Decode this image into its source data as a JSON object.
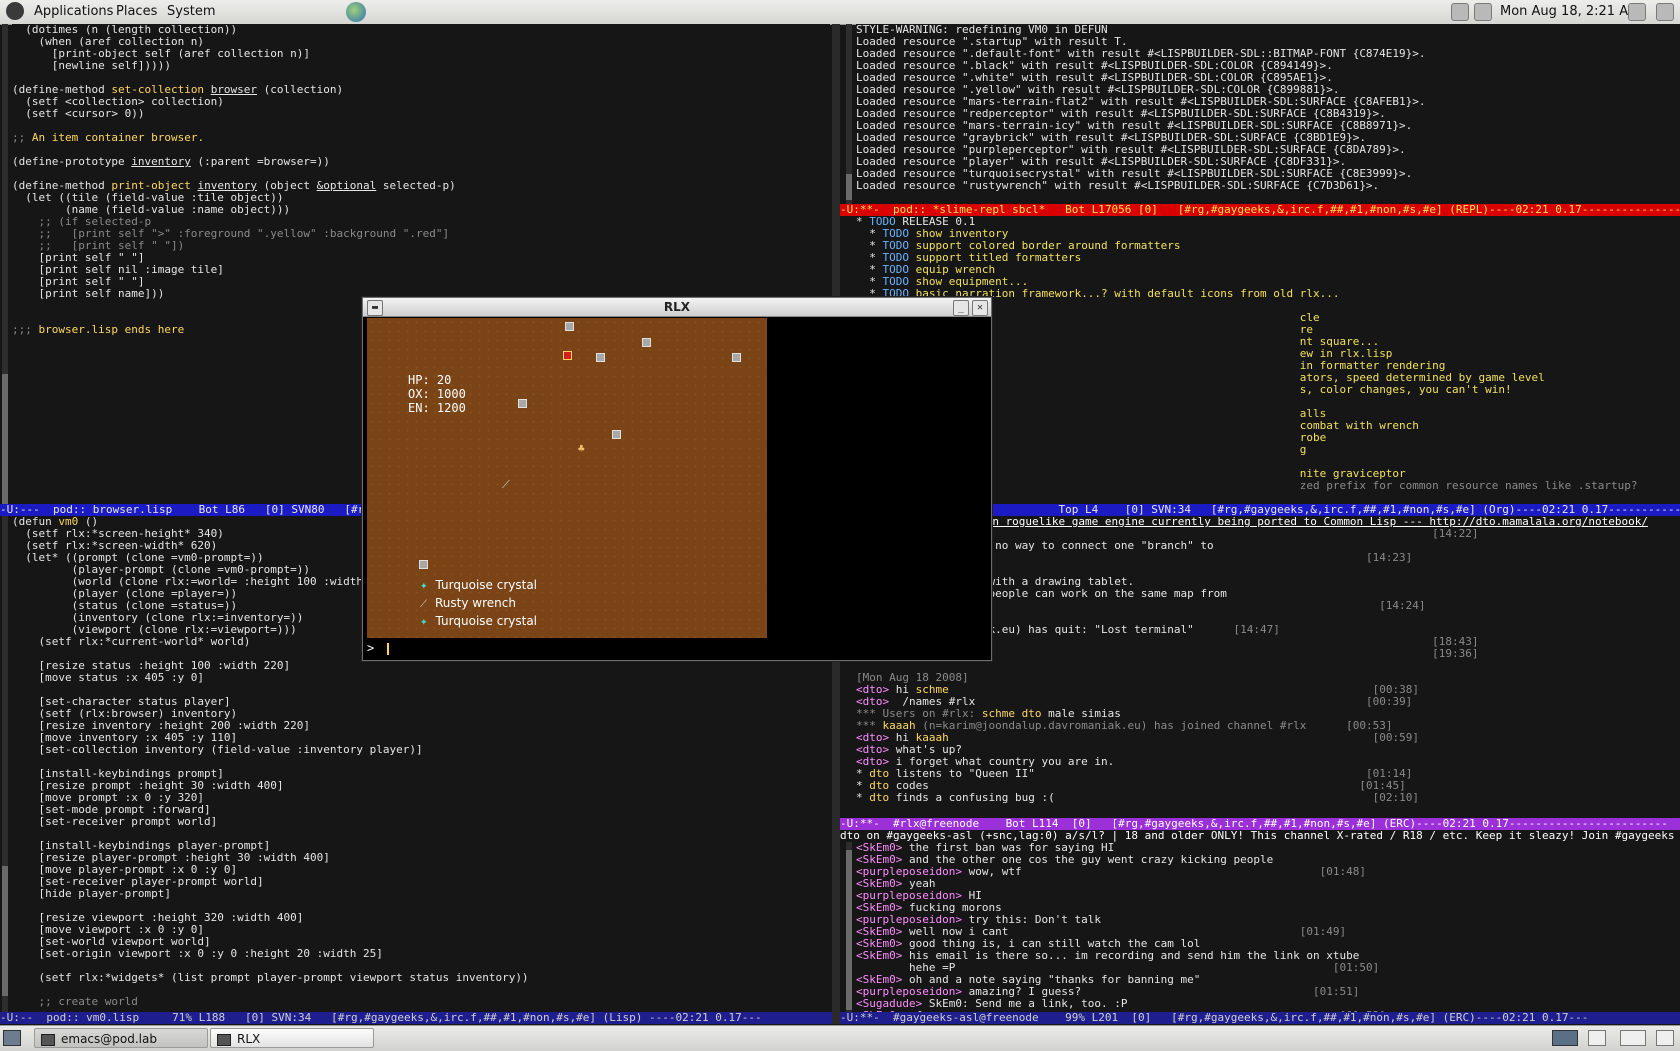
{
  "topbar": {
    "menus": [
      "Applications",
      "Places",
      "System"
    ],
    "clock": "Mon Aug 18,  2:21 AM"
  },
  "left_top": {
    "lines": [
      [
        "  (dotimes (n (length collection))"
      ],
      [
        "    (when (aref collection n)"
      ],
      [
        "      [print-object self (aref collection n)]"
      ],
      [
        "      [newline self]))))"
      ],
      [
        ""
      ],
      [
        "(define-method ",
        "kw:set-collection",
        " ",
        "ul:browser",
        " (collection)"
      ],
      [
        "  (setf <collection> collection)"
      ],
      [
        "  (setf <cursor> 0))"
      ],
      [
        ""
      ],
      [
        "cm:;; ",
        "kw:An item container browser."
      ],
      [
        ""
      ],
      [
        "(define-prototype ",
        "ul:inventory",
        " (:parent =browser=))"
      ],
      [
        ""
      ],
      [
        "(define-method ",
        "kw:print-object",
        " ",
        "ul:inventory",
        " (object ",
        "ul:&optional",
        " selected-p)"
      ],
      [
        "  (let ((tile (field-value :tile object))"
      ],
      [
        "        (name (field-value :name object)))"
      ],
      [
        "cm:    ;; (if selected-p"
      ],
      [
        "cm:    ;;   [print self \">\" :foreground \".yellow\" :background \".red\"]"
      ],
      [
        "cm:    ;;   [print self \" \"])"
      ],
      [
        "    [print self \" \"]"
      ],
      [
        "    [print self nil :image tile]"
      ],
      [
        "    [print self \" \"]"
      ],
      [
        "    [print self name]))"
      ],
      [
        ""
      ],
      [
        ""
      ],
      [
        "cm:;;; ",
        "kw:browser.lisp ends here"
      ]
    ],
    "modeline": "-U:---  pod:: browser.lisp    Bot L86   [0] SVN80   [#rg,#gaygeeks,&,irc.f,##,#1,#non,#s,#e] (Lisp) ----02:21 0.17---"
  },
  "left_bottom": {
    "lines": [
      [
        "(defun ",
        "kw:vm0",
        " ()"
      ],
      [
        "  (setf rlx:*screen-height* 340)"
      ],
      [
        "  (setf rlx:*screen-width* 620)"
      ],
      [
        "  (let* ((prompt (clone =vm0-prompt=))"
      ],
      [
        "         (player-prompt (clone =vm0-prompt=))"
      ],
      [
        "         (world (clone rlx:=world= :height 100 :width 100))"
      ],
      [
        "         (player (clone =player=))"
      ],
      [
        "         (status (clone =status=))"
      ],
      [
        "         (inventory (clone rlx:=inventory=))"
      ],
      [
        "         (viewport (clone rlx:=viewport=)))"
      ],
      [
        "    (setf rlx:*current-world* world)"
      ],
      [
        ""
      ],
      [
        "    [resize status :height 100 :width 220]"
      ],
      [
        "    [move status :x 405 :y 0]"
      ],
      [
        ""
      ],
      [
        "    [set-character status player]"
      ],
      [
        "    (setf (rlx:browser) inventory)"
      ],
      [
        "    [resize inventory :height 200 :width 220]"
      ],
      [
        "    [move inventory :x 405 :y 110]"
      ],
      [
        "    [set-collection inventory (field-value :inventory player)]"
      ],
      [
        ""
      ],
      [
        "    [install-keybindings prompt]"
      ],
      [
        "    [resize prompt :height 30 :width 400]"
      ],
      [
        "    [move prompt :x 0 :y 320]"
      ],
      [
        "    [set-mode prompt :forward]"
      ],
      [
        "    [set-receiver prompt world]"
      ],
      [
        ""
      ],
      [
        "    [install-keybindings player-prompt]"
      ],
      [
        "    [resize player-prompt :height 30 :width 400]"
      ],
      [
        "    [move player-prompt :x 0 :y 0]"
      ],
      [
        "    [set-receiver player-prompt world]"
      ],
      [
        "    [hide player-prompt]"
      ],
      [
        ""
      ],
      [
        "    [resize viewport :height 320 :width 400]"
      ],
      [
        "    [move viewport :x 0 :y 0]"
      ],
      [
        "    [set-world viewport world]"
      ],
      [
        "    [set-origin viewport :x 0 :y 0 :height 20 :width 25]"
      ],
      [
        ""
      ],
      [
        "    (setf rlx:*widgets* (list prompt player-prompt viewport status inventory))"
      ],
      [
        ""
      ],
      [
        "cm:    ;; create world"
      ]
    ],
    "modeline": "-U:--  pod:: vm0.lisp     71% L188   [0] SVN:34   [#rg,#gaygeeks,&,irc.f,##,#1,#non,#s,#e] (Lisp) ----02:21 0.17---"
  },
  "repl": {
    "lines": [
      [
        "STYLE-WARNING: redefining VM0 in DEFUN"
      ],
      [
        "Loaded resource \".startup\" with result T."
      ],
      [
        "Loaded resource \".default-font\" with result #<LISPBUILDER-SDL::BITMAP-FONT {C874E19}>."
      ],
      [
        "Loaded resource \".black\" with result #<LISPBUILDER-SDL:COLOR {C894149}>."
      ],
      [
        "Loaded resource \".white\" with result #<LISPBUILDER-SDL:COLOR {C895AE1}>."
      ],
      [
        "Loaded resource \".yellow\" with result #<LISPBUILDER-SDL:COLOR {C899881}>."
      ],
      [
        "Loaded resource \"mars-terrain-flat2\" with result #<LISPBUILDER-SDL:SURFACE {C8AFEB1}>."
      ],
      [
        "Loaded resource \"redperceptor\" with result #<LISPBUILDER-SDL:SURFACE {C8B4319}>."
      ],
      [
        "Loaded resource \"mars-terrain-icy\" with result #<LISPBUILDER-SDL:SURFACE {C8B8971}>."
      ],
      [
        "Loaded resource \"graybrick\" with result #<LISPBUILDER-SDL:SURFACE {C8BD1E9}>."
      ],
      [
        "Loaded resource \"purpleperceptor\" with result #<LISPBUILDER-SDL:SURFACE {C8DA789}>."
      ],
      [
        "Loaded resource \"player\" with result #<LISPBUILDER-SDL:SURFACE {C8DF331}>."
      ],
      [
        "Loaded resource \"turquoisecrystal\" with result #<LISPBUILDER-SDL:SURFACE {C8E3999}>."
      ],
      [
        "Loaded resource \"rustywrench\" with result #<LISPBUILDER-SDL:SURFACE {C7D3D61}>."
      ],
      [
        ""
      ]
    ],
    "modeline": "-U:**-  pod:: *slime-repl sbcl*   Bot L17056 [0]   [#rg,#gaygeeks,&,irc.f,##,#1,#non,#s,#e] (REPL)----02:21 0.17-----------------------"
  },
  "org": {
    "lines": [
      [
        "* ",
        "todo:TODO",
        " RELEASE 0.1"
      ],
      [
        "  * ",
        "todo:TODO",
        " ",
        "yel:show inventory"
      ],
      [
        "  * ",
        "todo:TODO",
        " ",
        "yel:support colored border around formatters"
      ],
      [
        "  * ",
        "todo:TODO",
        " ",
        "yel:support titled formatters"
      ],
      [
        "  * ",
        "todo:TODO",
        " ",
        "yel:equip wrench"
      ],
      [
        "  * ",
        "todo:TODO",
        " ",
        "yel:show equipment..."
      ],
      [
        "  * ",
        "todo:TODO",
        " ",
        "yel:basic narration framework...? with default icons from old rlx..."
      ],
      [
        ""
      ],
      [
        "                                                                   ",
        "yel:cle"
      ],
      [
        "                                                                   ",
        "yel:re"
      ],
      [
        "                                                                   ",
        "yel:nt square..."
      ],
      [
        "                                                                   ",
        "yel:ew in rlx.lisp"
      ],
      [
        "                                                                   ",
        "yel:in formatter rendering"
      ],
      [
        "                                                                   ",
        "yel:ators, speed determined by game level"
      ],
      [
        "                                                                   ",
        "yel:s, color changes, you can't win!"
      ],
      [
        ""
      ],
      [
        "                                                                   ",
        "yel:alls"
      ],
      [
        "                                                                   ",
        "yel:combat with wrench"
      ],
      [
        "                                                                   ",
        "yel:robe"
      ],
      [
        "                                                                   ",
        "yel:g"
      ],
      [
        ""
      ],
      [
        "                                                                   ",
        "yel:nite graviceptor"
      ],
      [
        "                                                                   ",
        "cm:zed prefix for common resource names like .startup?"
      ]
    ],
    "modeline": "-U:---  pod:: TODO               Top L4    [0] SVN:34   [#rg,#gaygeeks,&,irc.f,##,#1,#non,#s,#e] (Org)----02:21 0.17-----------------"
  },
  "erc_rlx": {
    "topic": "RLX is a next-generation roguelike game engine currently being ported to Common Lisp --- http://dto.mamalala.org/notebook/",
    "lines": [
      [
        "",
        "ts:                                                                                       [14:22]"
      ],
      [
        "ertain things.. like no way to connect one \"branch\" to"
      ],
      [
        "ch\"",
        "ts:                                                                          [14:23]"
      ],
      [
        "y to insert pictures."
      ],
      [
        "d like it hooked up with a drawing tablet."
      ],
      [
        " make it so several people can work on the same map from"
      ],
      [
        "s.",
        "ts:                                                                             [14:24]"
      ],
      [
        " go to bed :D"
      ],
      [
        "joondalup.davromaniak.eu) has quit: \"Lost terminal\"",
        "ts:      [14:47]"
      ],
      [
        "",
        "ts:                                                                                       [18:43]"
      ],
      [
        "",
        "ts:                                                                                       [19:36]"
      ],
      [
        ""
      ],
      [
        "ts:[Mon Aug 18 2008]"
      ],
      [
        "nick:<dto>",
        " hi ",
        "kw:schme",
        "ts:                                                                [00:38]"
      ],
      [
        "nick:<dto>",
        "  /names #rlx",
        "ts:                                                           [00:39]"
      ],
      [
        "cm:*** Users on #rlx: ",
        "kw:schme dto",
        " male simias"
      ],
      [
        "cm:*** ",
        "kw:kaaah",
        "cm: (n=karim@joondalup.davromaniak.eu) has joined channel #rlx",
        "ts:      [00:53]"
      ],
      [
        "nick:<dto>",
        " hi ",
        "kw:kaaah",
        "ts:                                                                [00:59]"
      ],
      [
        "nick:<dto>",
        " what's up?"
      ],
      [
        "nick:<dto>",
        " i forget what country you are in."
      ],
      [
        "* ",
        "kw:dto",
        " listens to \"Queen II\"",
        "ts:                                                  [01:14]"
      ],
      [
        "* ",
        "kw:dto",
        " codes",
        "ts:                                                                 [01:45]"
      ],
      [
        "* ",
        "kw:dto",
        " finds a confusing bug :(",
        "ts:                                                [02:10]"
      ],
      [
        "ERC> "
      ]
    ],
    "modeline": "-U:**-  #rlx@freenode    Bot L114  [0]   [#rg,#gaygeeks,&,irc.f,##,#1,#non,#s,#e] (ERC)----02:21 0.17------------------------"
  },
  "erc_gaygeeks": {
    "topic": "dto on #gaygeeks-asl (+snc,lag:0) a/s/l? | 18 and older ONLY! This channel X-rated / R18 / etc. Keep it sleazy! Join #gaygeeks for clean(er)",
    "lines": [
      [
        "nick:<SkEm0>",
        " the first ban was for saying HI"
      ],
      [
        "nick:<SkEm0>",
        " and the other one cos the guy went crazy kicking people"
      ],
      [
        "nick:<purpleposeidon>",
        " wow, wtf",
        "ts:                                             [01:48]"
      ],
      [
        "nick:<SkEm0>",
        " yeah"
      ],
      [
        "nick:<purpleposeidon>",
        " HI"
      ],
      [
        "nick:<SkEm0>",
        " fucking morons"
      ],
      [
        "nick:<purpleposeidon>",
        " try this: Don't talk"
      ],
      [
        "nick:<SkEm0>",
        " well now i cant",
        "ts:                                            [01:49]"
      ],
      [
        "nick:<SkEm0>",
        " good thing is, i can still watch the cam lol"
      ],
      [
        "nick:<SkEm0>",
        " his email is there so... im recording and send him the link on xtube"
      ],
      [
        "        hehe =P",
        "ts:                                                         [01:50]"
      ],
      [
        "nick:<SkEm0>",
        " oh and a note saying \"thanks for banning me\""
      ],
      [
        "nick:<purpleposeidon>",
        " amazing? I guess?",
        "ts:                                   [01:51]"
      ],
      [
        "nick:<Sugadude>",
        " SkEm0: Send me a link, too. :P"
      ],
      [
        "nick:<SkEm0>",
        " of course",
        "ts:                                                        [01:52]"
      ]
    ],
    "modeline": "-U:**-  #gaygeeks-asl@freenode    99% L201  [0]   [#rg,#gaygeeks,&,irc.f,##,#1,#non,#s,#e] (ERC)----02:21 0.17---"
  },
  "game_window": {
    "title": "RLX",
    "status": [
      "HP: 20",
      "OX: 1000",
      "EN: 1200"
    ],
    "inventory": [
      {
        "icon": "turquoise-crystal-icon",
        "name": "Turquoise crystal"
      },
      {
        "icon": "rusty-wrench-icon",
        "name": "Rusty wrench"
      },
      {
        "icon": "turquoise-crystal-icon",
        "name": "Turquoise crystal"
      }
    ],
    "prompt": ">",
    "colors": {
      "terrain": "#7a4416",
      "rock": "#a8a8a8",
      "perceptor": "#d22020"
    }
  },
  "taskbar": {
    "tasks": [
      "emacs@pod.lab",
      "RLX"
    ]
  }
}
